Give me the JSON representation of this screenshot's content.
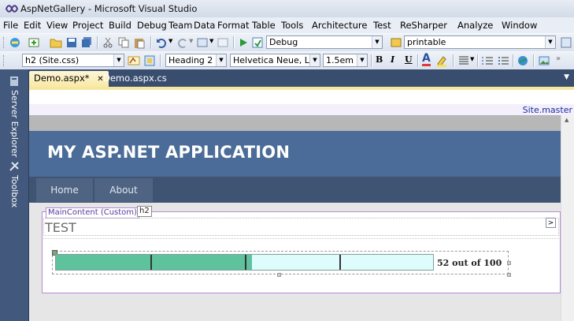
{
  "window": {
    "title": "AspNetGallery - Microsoft Visual Studio"
  },
  "menu": [
    "File",
    "Edit",
    "View",
    "Project",
    "Build",
    "Debug",
    "Team",
    "Data",
    "Format",
    "Table",
    "Tools",
    "Architecture",
    "Test",
    "ReSharper",
    "Analyze",
    "Window"
  ],
  "toolbar1": {
    "config_value": "Debug",
    "platform_value": "printable"
  },
  "toolbar2": {
    "target_rule": "h2 (Site.css)",
    "block_format": "Heading 2",
    "font_name": "Helvetica Neue, L",
    "font_size": "1.5em",
    "bold": "B",
    "italic": "I",
    "underline": "U",
    "font_color": "A"
  },
  "side_tabs": {
    "server_explorer": "Server Explorer",
    "toolbox": "Toolbox"
  },
  "doc_tabs": {
    "active": "Demo.aspx*",
    "close": "✕",
    "other": "Demo.aspx.cs"
  },
  "designer": {
    "master_label": "Site.master",
    "app_title": "MY ASP.NET APPLICATION",
    "nav": {
      "home": "Home",
      "about": "About"
    },
    "content_tag": "MainContent (Custom)",
    "element_tag": "h2",
    "heading": "TEST",
    "smart_tag": ">",
    "progress": {
      "value": 52,
      "max": 100,
      "text": "52 out of 100"
    },
    "colors": {
      "fill": "#5ec39d",
      "track": "#dffcfc",
      "header": "#4b6c98",
      "nav": "#3f5473"
    }
  }
}
